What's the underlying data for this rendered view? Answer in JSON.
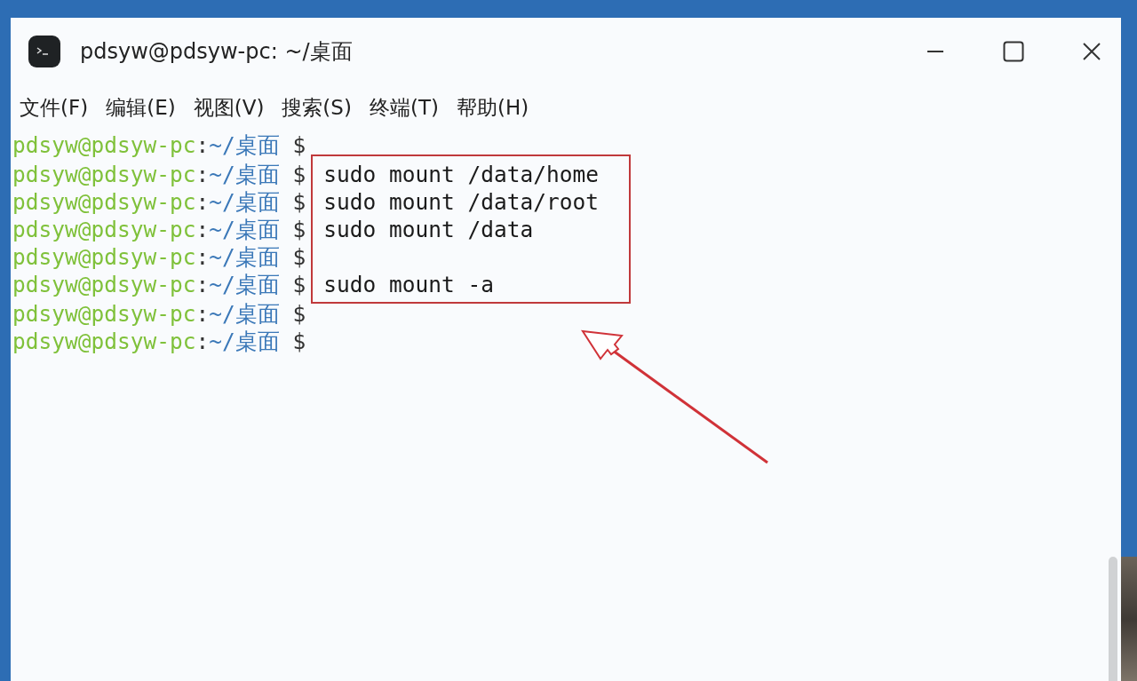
{
  "window": {
    "title": "pdsyw@pdsyw-pc: ~/桌面"
  },
  "menu": [
    "文件(F)",
    "编辑(E)",
    "视图(V)",
    "搜索(S)",
    "终端(T)",
    "帮助(H)"
  ],
  "terminal": {
    "blocks": [
      {
        "boxed": false,
        "lines": [
          {
            "user_host": "pdsyw@pdsyw-pc",
            "separator": ":",
            "path": "~/桌面",
            "symbol": "$"
          }
        ]
      },
      {
        "boxed": true,
        "lines": [
          {
            "user_host": "pdsyw@pdsyw-pc",
            "separator": ":",
            "path": "~/桌面",
            "symbol": "$",
            "command": "sudo mount /data/home"
          },
          {
            "user_host": "pdsyw@pdsyw-pc",
            "separator": ":",
            "path": "~/桌面",
            "symbol": "$",
            "command": "sudo mount /data/root"
          },
          {
            "user_host": "pdsyw@pdsyw-pc",
            "separator": ":",
            "path": "~/桌面",
            "symbol": "$",
            "command": "sudo mount /data"
          },
          {
            "user_host": "pdsyw@pdsyw-pc",
            "separator": ":",
            "path": "~/桌面",
            "symbol": "$"
          },
          {
            "user_host": "pdsyw@pdsyw-pc",
            "separator": ":",
            "path": "~/桌面",
            "symbol": "$",
            "command": "sudo mount -a"
          }
        ]
      },
      {
        "boxed": false,
        "lines": [
          {
            "user_host": "pdsyw@pdsyw-pc",
            "separator": ":",
            "path": "~/桌面",
            "symbol": "$"
          },
          {
            "user_host": "pdsyw@pdsyw-pc",
            "separator": ":",
            "path": "~/桌面",
            "symbol": "$"
          }
        ]
      }
    ]
  }
}
